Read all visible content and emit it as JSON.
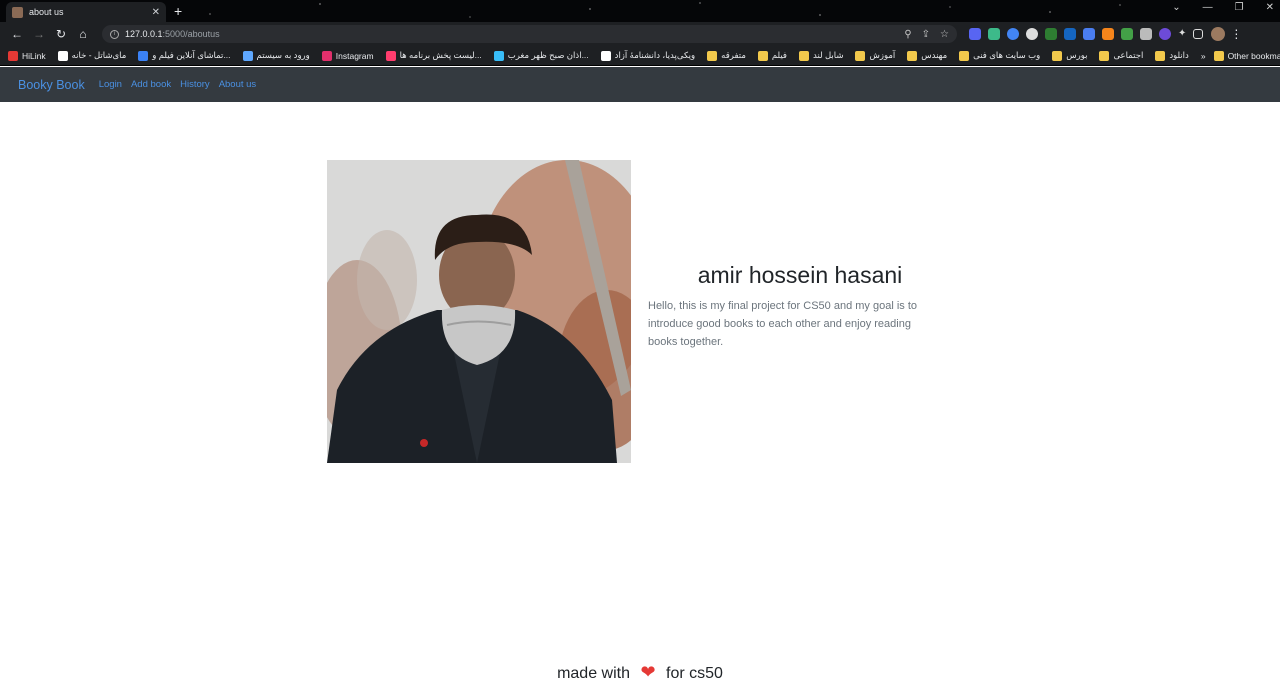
{
  "browser": {
    "tab_title": "about us",
    "url_host": "127.0.0.1",
    "url_path": ":5000/aboutus",
    "bookmarks": [
      {
        "label": "HiLink",
        "icon": "huawei-icon",
        "color": "#e53935"
      },
      {
        "label": "مای‌شاتل - خانه",
        "icon": "shatel-icon",
        "color": "#ffffff"
      },
      {
        "label": "تماشای آنلاین فیلم و...",
        "icon": "netflix-icon",
        "color": "#3b82f6"
      },
      {
        "label": "ورود به سیستم",
        "icon": "login-icon",
        "color": "#5fa8ff"
      },
      {
        "label": "Instagram",
        "icon": "instagram-icon",
        "color": "#e1306c"
      },
      {
        "label": "لیست پخش برنامه ها...",
        "icon": "playlist-icon",
        "color": "#ff3d6e"
      },
      {
        "label": "اذان صبح ظهر مغرب...",
        "icon": "azan-icon",
        "color": "#38bdf8"
      },
      {
        "label": "ویکی‌پدیا، دانشنامهٔ آزاد",
        "icon": "wikipedia-icon",
        "color": "#ffffff"
      },
      {
        "label": "متفرقه",
        "icon": "folder-icon",
        "color": "#f2c94c"
      },
      {
        "label": "فیلم",
        "icon": "folder-icon",
        "color": "#f2c94c"
      },
      {
        "label": "شابل لند",
        "icon": "folder-icon",
        "color": "#f2c94c"
      },
      {
        "label": "آموزش",
        "icon": "folder-icon",
        "color": "#f2c94c"
      },
      {
        "label": "مهندس",
        "icon": "folder-icon",
        "color": "#f2c94c"
      },
      {
        "label": "وب سایت های فنی",
        "icon": "folder-icon",
        "color": "#f2c94c"
      },
      {
        "label": "بورس",
        "icon": "folder-icon",
        "color": "#f2c94c"
      },
      {
        "label": "اجتماعی",
        "icon": "folder-icon",
        "color": "#f2c94c"
      },
      {
        "label": "دانلود",
        "icon": "folder-icon",
        "color": "#f2c94c"
      }
    ],
    "overflow_label": "»",
    "other_bookmarks": "Other bookmarks"
  },
  "navbar": {
    "brand": "Booky Book",
    "links": [
      "Login",
      "Add book",
      "History",
      "About us"
    ]
  },
  "about": {
    "name": "amir hossein hasani",
    "bio": "Hello, this is my final project for CS50 and my goal is to introduce good books to each other and enjoy reading books together."
  },
  "footer": {
    "before": "made with",
    "heart": "❤",
    "after": "for cs50"
  },
  "colors": {
    "navbar_bg": "#343a40",
    "link": "#4a90e2",
    "heart": "#e53935"
  }
}
